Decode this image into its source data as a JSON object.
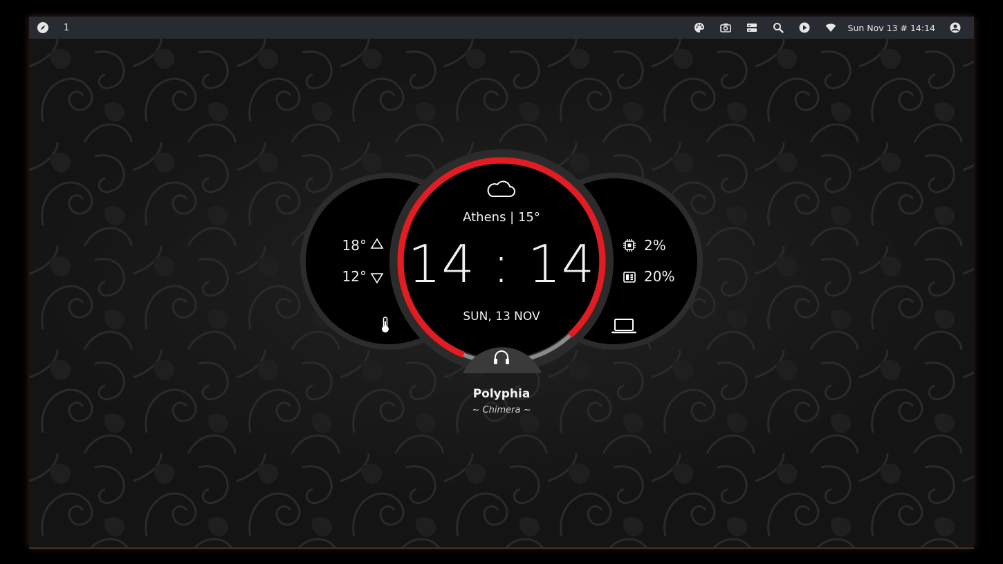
{
  "topbar": {
    "workspace": "1",
    "datetime": "Sun Nov 13 # 14:14",
    "icons": [
      "compass-icon",
      "palette-icon",
      "camera-icon",
      "storage-icon",
      "search-icon",
      "play-icon",
      "wifi-icon",
      "user-icon"
    ]
  },
  "weather": {
    "city_temp": "Athens | 15°",
    "high": "18°",
    "low": "12°",
    "icon": "cloud-icon"
  },
  "clock": {
    "time": "14 : 14",
    "date": "SUN, 13 NOV",
    "ring_progress": 0.82,
    "ring_color": "#e21c21"
  },
  "system": {
    "cpu": "2%",
    "memory": "20%"
  },
  "music": {
    "artist": "Polyphia",
    "song": "~ Chimera ~"
  },
  "colors": {
    "accent": "#e21c21",
    "bar_bg": "#282b31",
    "panel_bg": "#000000",
    "ring_bg": "#2b2b2b"
  }
}
